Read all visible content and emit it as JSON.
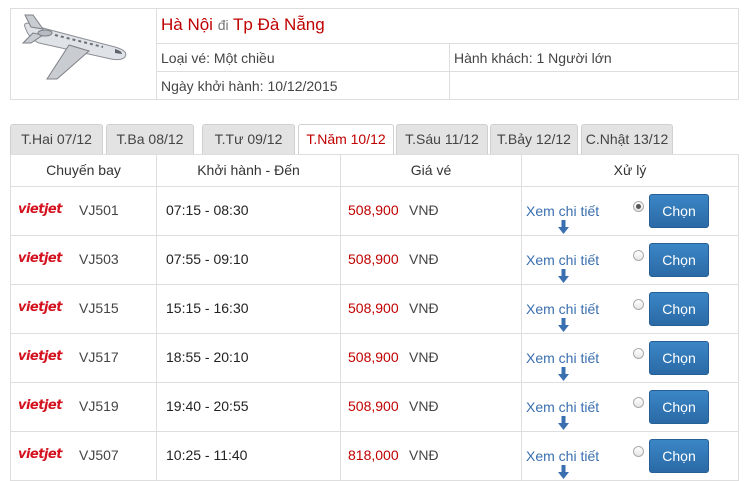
{
  "header": {
    "from": "Hà Nội",
    "connector": "đi",
    "to": "Tp Đà Nẵng",
    "ticket_type": "Loại vé: Một chiều",
    "passengers": "Hành khách: 1 Người lớn",
    "departure_date": "Ngày khởi hành: 10/12/2015"
  },
  "tabs": [
    {
      "label": "T.Hai 07/12",
      "active": false
    },
    {
      "label": "T.Ba 08/12",
      "active": false
    },
    {
      "label": "T.Tư 09/12",
      "active": false
    },
    {
      "label": "T.Năm 10/12",
      "active": true
    },
    {
      "label": "T.Sáu 11/12",
      "active": false
    },
    {
      "label": "T.Bảy 12/12",
      "active": false
    },
    {
      "label": "C.Nhật 13/12",
      "active": false
    }
  ],
  "table": {
    "columns": [
      "Chuyến bay",
      "Khởi hành - Đến",
      "Giá vé",
      "Xử lý"
    ],
    "rows": [
      {
        "airline": "vietjet",
        "flight": "VJ501",
        "time": "07:15 - 08:30",
        "price": "508,900",
        "currency": "VNĐ",
        "detail": "Xem chi tiết",
        "selected": true,
        "action": "Chọn"
      },
      {
        "airline": "vietjet",
        "flight": "VJ503",
        "time": "07:55 - 09:10",
        "price": "508,900",
        "currency": "VNĐ",
        "detail": "Xem chi tiết",
        "selected": false,
        "action": "Chọn"
      },
      {
        "airline": "vietjet",
        "flight": "VJ515",
        "time": "15:15 - 16:30",
        "price": "508,900",
        "currency": "VNĐ",
        "detail": "Xem chi tiết",
        "selected": false,
        "action": "Chọn"
      },
      {
        "airline": "vietjet",
        "flight": "VJ517",
        "time": "18:55 - 20:10",
        "price": "508,900",
        "currency": "VNĐ",
        "detail": "Xem chi tiết",
        "selected": false,
        "action": "Chọn"
      },
      {
        "airline": "vietjet",
        "flight": "VJ519",
        "time": "19:40 - 20:55",
        "price": "508,900",
        "currency": "VNĐ",
        "detail": "Xem chi tiết",
        "selected": false,
        "action": "Chọn"
      },
      {
        "airline": "vietjet",
        "flight": "VJ507",
        "time": "10:25 - 11:40",
        "price": "818,000",
        "currency": "VNĐ",
        "detail": "Xem chi tiết",
        "selected": false,
        "action": "Chọn"
      }
    ]
  },
  "colors": {
    "accent_red": "#c00000",
    "link_blue": "#3a6fb0",
    "button_blue": "#2f75b5",
    "vietjet_red": "#d4111e"
  },
  "icons": {
    "plane": "airplane-icon",
    "arrow": "arrow-down-icon"
  }
}
